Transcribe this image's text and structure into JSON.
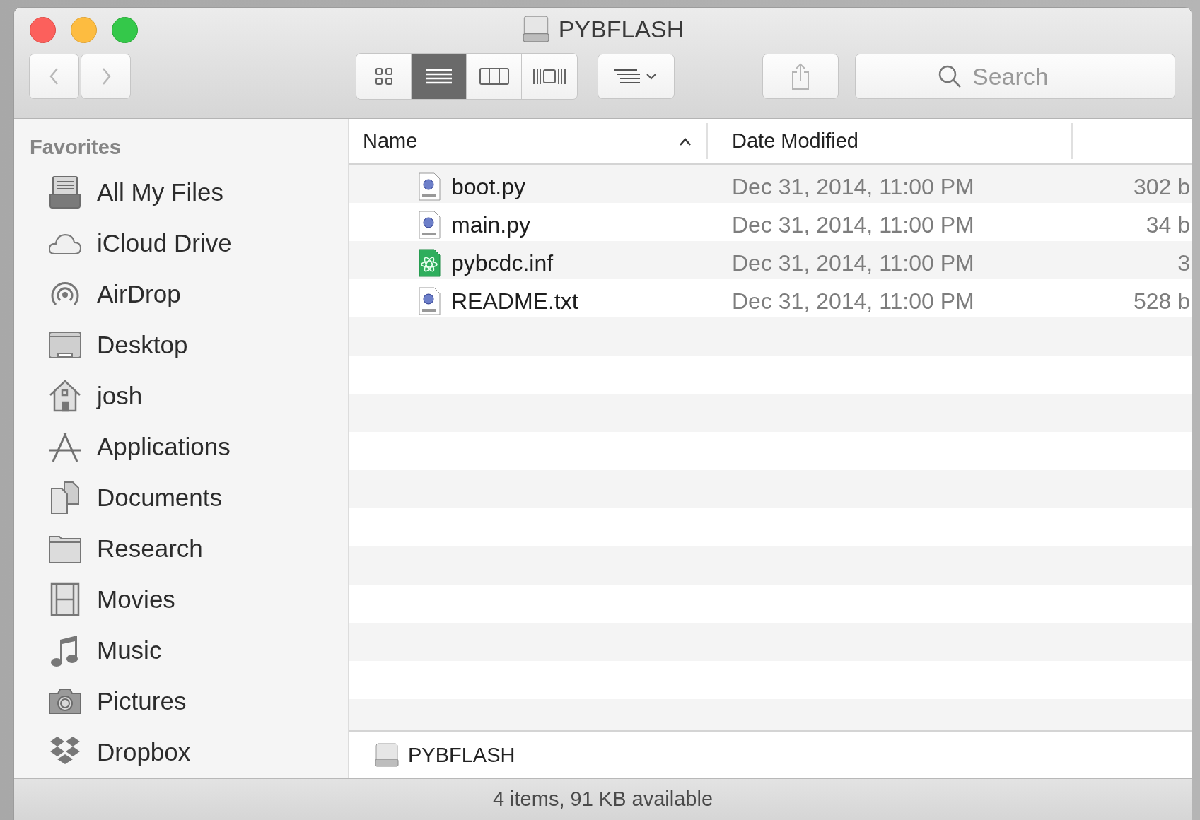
{
  "window": {
    "title": "PYBFLASH"
  },
  "toolbar": {
    "view_modes": [
      {
        "kind": "icons",
        "selected": false
      },
      {
        "kind": "list",
        "selected": true
      },
      {
        "kind": "columns",
        "selected": false
      },
      {
        "kind": "coverflow",
        "selected": false
      }
    ],
    "search": {
      "placeholder": "Search"
    }
  },
  "sidebar": {
    "heading": "Favorites",
    "items": [
      {
        "label": "All My Files"
      },
      {
        "label": "iCloud Drive"
      },
      {
        "label": "AirDrop"
      },
      {
        "label": "Desktop"
      },
      {
        "label": "josh"
      },
      {
        "label": "Applications"
      },
      {
        "label": "Documents"
      },
      {
        "label": "Research"
      },
      {
        "label": "Movies"
      },
      {
        "label": "Music"
      },
      {
        "label": "Pictures"
      },
      {
        "label": "Dropbox"
      }
    ]
  },
  "table": {
    "columns": [
      {
        "label": "Name",
        "sorted": true
      },
      {
        "label": "Date Modified",
        "sorted": false
      }
    ],
    "rows": [
      {
        "name": "boot.py",
        "kind": "text",
        "date": "Dec 31, 2014, 11:00 PM",
        "size": "302 b"
      },
      {
        "name": "main.py",
        "kind": "text",
        "date": "Dec 31, 2014, 11:00 PM",
        "size": "34 b"
      },
      {
        "name": "pybcdc.inf",
        "kind": "atom",
        "date": "Dec 31, 2014, 11:00 PM",
        "size": "3"
      },
      {
        "name": "README.txt",
        "kind": "text",
        "date": "Dec 31, 2014, 11:00 PM",
        "size": "528 b"
      }
    ]
  },
  "path_bar": {
    "label": "PYBFLASH"
  },
  "status_bar": "4 items, 91 KB available"
}
